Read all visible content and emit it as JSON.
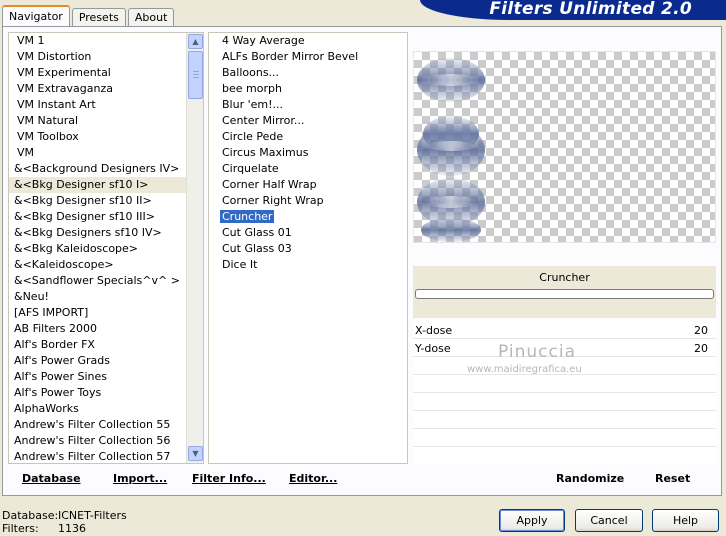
{
  "tabs": [
    {
      "label": "Navigator",
      "active": true
    },
    {
      "label": "Presets",
      "active": false
    },
    {
      "label": "About",
      "active": false
    }
  ],
  "banner": {
    "title": "Filters Unlimited 2.0"
  },
  "categories": [
    {
      "label": "VM 1",
      "vm": true
    },
    {
      "label": "VM Distortion",
      "vm": true
    },
    {
      "label": "VM Experimental",
      "vm": true
    },
    {
      "label": "VM Extravaganza",
      "vm": true
    },
    {
      "label": "VM Instant Art",
      "vm": true
    },
    {
      "label": "VM Natural",
      "vm": true
    },
    {
      "label": "VM Toolbox",
      "vm": true
    },
    {
      "label": "VM",
      "vm": true
    },
    {
      "label": "&<Background Designers IV>"
    },
    {
      "label": "&<Bkg Designer sf10 I>",
      "selected": true
    },
    {
      "label": "&<Bkg Designer sf10 II>"
    },
    {
      "label": "&<Bkg Designer sf10 III>"
    },
    {
      "label": "&<Bkg Designers sf10 IV>"
    },
    {
      "label": "&<Bkg Kaleidoscope>"
    },
    {
      "label": "&<Kaleidoscope>"
    },
    {
      "label": "&<Sandflower Specials^v^ >"
    },
    {
      "label": "&Neu!"
    },
    {
      "label": "[AFS IMPORT]"
    },
    {
      "label": "AB Filters 2000"
    },
    {
      "label": "Alf's Border FX"
    },
    {
      "label": "Alf's Power Grads"
    },
    {
      "label": "Alf's Power Sines"
    },
    {
      "label": "Alf's Power Toys"
    },
    {
      "label": "AlphaWorks"
    },
    {
      "label": "Andrew's Filter Collection 55"
    },
    {
      "label": "Andrew's Filter Collection 56"
    },
    {
      "label": "Andrew's Filter Collection 57"
    }
  ],
  "filters": [
    {
      "label": "4 Way Average"
    },
    {
      "label": "ALFs Border Mirror Bevel"
    },
    {
      "label": "Balloons..."
    },
    {
      "label": "bee morph"
    },
    {
      "label": "Blur 'em!..."
    },
    {
      "label": "Center Mirror..."
    },
    {
      "label": "Circle Pede"
    },
    {
      "label": "Circus Maximus"
    },
    {
      "label": "Cirquelate"
    },
    {
      "label": "Corner Half Wrap"
    },
    {
      "label": "Corner Right Wrap"
    },
    {
      "label": "Cruncher",
      "selected": true
    },
    {
      "label": "Cut Glass 01"
    },
    {
      "label": "Cut Glass 03"
    },
    {
      "label": "Dice It"
    }
  ],
  "preview": {
    "filter_name": "Cruncher",
    "progress": 0
  },
  "params": [
    {
      "label": "X-dose",
      "value": "20"
    },
    {
      "label": "Y-dose",
      "value": "20"
    }
  ],
  "watermark": {
    "line1": "Pinuccia",
    "line2": "www.maidiregrafica.eu"
  },
  "actions": {
    "database": "Database",
    "import": "Import...",
    "filter_info": "Filter Info...",
    "editor": "Editor...",
    "randomize": "Randomize",
    "reset": "Reset"
  },
  "footer": {
    "database_label": "Database:",
    "database_value": "ICNET-Filters",
    "filters_label": "Filters:",
    "filters_value": "1136"
  },
  "buttons": {
    "apply": "Apply",
    "cancel": "Cancel",
    "help": "Help"
  },
  "colors": {
    "accent": "#316ac5",
    "banner": "#0a2a8e",
    "face": "#ece9d8"
  }
}
